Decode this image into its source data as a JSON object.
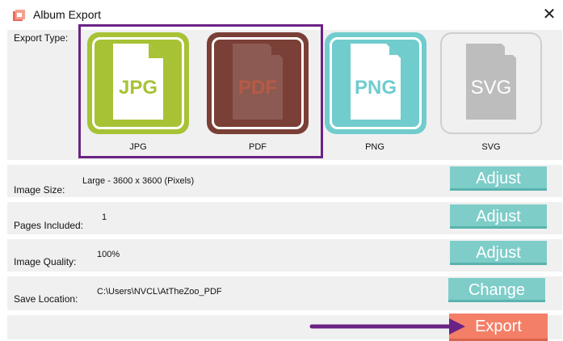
{
  "window": {
    "title": "Album Export",
    "close_symbol": "✕"
  },
  "export_type": {
    "label": "Export Type:",
    "options": [
      {
        "name": "JPG",
        "caption": "JPG",
        "color": "#a7c335"
      },
      {
        "name": "PDF",
        "caption": "PDF",
        "color": "#7a3f36"
      },
      {
        "name": "PNG",
        "caption": "PNG",
        "color": "#71cccd"
      },
      {
        "name": "SVG",
        "caption": "SVG",
        "color": "#f0f0f0"
      }
    ]
  },
  "settings": [
    {
      "label": "Image Size:",
      "value": "Large - 3600 x 3600 (Pixels)",
      "button": "Adjust"
    },
    {
      "label": "Pages Included:",
      "value": "1",
      "button": "Adjust"
    },
    {
      "label": "Image Quality:",
      "value": "100%",
      "button": "Adjust"
    },
    {
      "label": "Save Location:",
      "value": "C:\\Users\\NVCL\\AtTheZoo_PDF",
      "button": "Change"
    }
  ],
  "export_button": "Export",
  "colors": {
    "button_teal": "#7ecdc9",
    "button_export": "#f47f67",
    "highlight_purple": "#6a2385"
  }
}
